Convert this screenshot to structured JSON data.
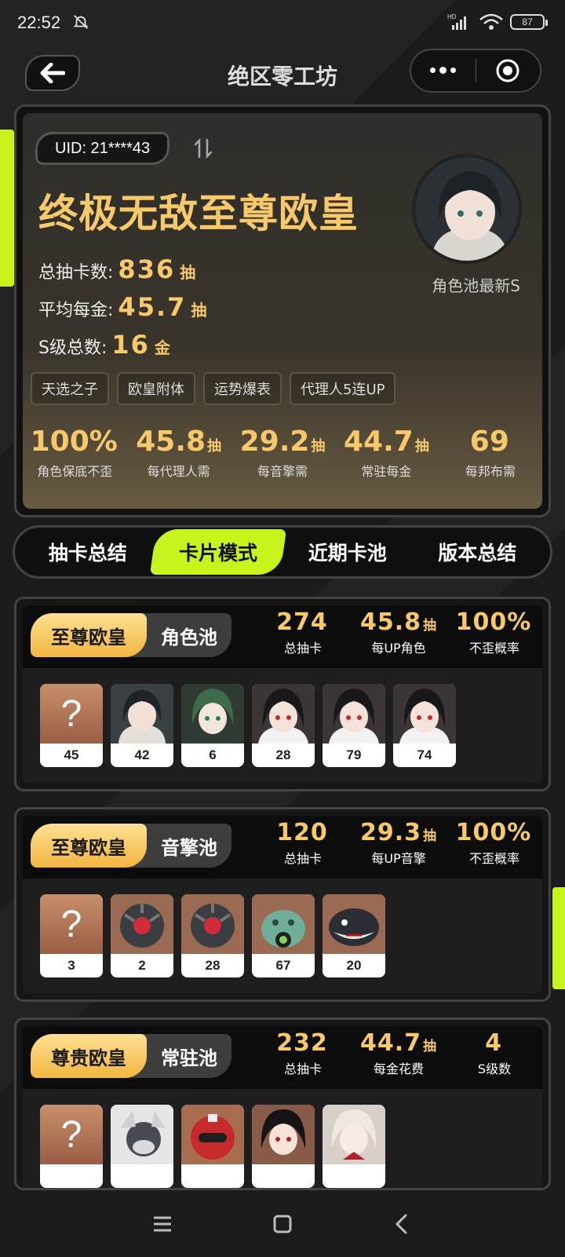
{
  "status_bar": {
    "time": "22:52",
    "battery": "87"
  },
  "header": {
    "title": "绝区零工坊"
  },
  "profile": {
    "uid": "UID: 21****43",
    "rank_title": "终极无敌至尊欧皇",
    "total_pulls_label": "总抽卡数:",
    "total_pulls": "836",
    "avg_gold_label": "平均每金:",
    "avg_gold": "45.7",
    "s_total_label": "S级总数:",
    "s_total": "16",
    "unit_pull": "抽",
    "unit_gold": "金",
    "avatar_caption": "角色池最新S",
    "tags": [
      "天选之子",
      "欧皇附体",
      "运势爆表",
      "代理人5连UP"
    ],
    "summary": [
      {
        "value": "100%",
        "unit": "",
        "label": "角色保底不歪"
      },
      {
        "value": "45.8",
        "unit": "抽",
        "label": "每代理人需"
      },
      {
        "value": "29.2",
        "unit": "抽",
        "label": "每音擎需"
      },
      {
        "value": "44.7",
        "unit": "抽",
        "label": "常驻每金"
      },
      {
        "value": "69",
        "unit": "",
        "label": "每邦布需"
      }
    ]
  },
  "tabs": [
    {
      "label": "抽卡总结",
      "active": false
    },
    {
      "label": "卡片模式",
      "active": true
    },
    {
      "label": "近期卡池",
      "active": false
    },
    {
      "label": "版本总结",
      "active": false
    }
  ],
  "pools": [
    {
      "rank": "至尊欧皇",
      "name": "角色池",
      "stats": [
        {
          "value": "274",
          "unit": "",
          "label": "总抽卡"
        },
        {
          "value": "45.8",
          "unit": "抽",
          "label": "每UP角色"
        },
        {
          "value": "100%",
          "unit": "",
          "label": "不歪概率"
        }
      ],
      "cards": [
        {
          "kind": "unknown",
          "count": "45"
        },
        {
          "kind": "char-dark-hair",
          "count": "42"
        },
        {
          "kind": "char-green-hair",
          "count": "6"
        },
        {
          "kind": "char-black-red",
          "count": "28"
        },
        {
          "kind": "char-black-red",
          "count": "79"
        },
        {
          "kind": "char-black-red",
          "count": "74"
        }
      ]
    },
    {
      "rank": "至尊欧皇",
      "name": "音擎池",
      "stats": [
        {
          "value": "120",
          "unit": "",
          "label": "总抽卡"
        },
        {
          "value": "29.3",
          "unit": "抽",
          "label": "每UP音擎"
        },
        {
          "value": "100%",
          "unit": "",
          "label": "不歪概率"
        }
      ],
      "cards": [
        {
          "kind": "unknown",
          "count": "3"
        },
        {
          "kind": "engine-gray",
          "count": "2"
        },
        {
          "kind": "engine-gray",
          "count": "28"
        },
        {
          "kind": "engine-teal",
          "count": "67"
        },
        {
          "kind": "engine-orca",
          "count": "20"
        }
      ]
    },
    {
      "rank": "尊贵欧皇",
      "name": "常驻池",
      "stats": [
        {
          "value": "232",
          "unit": "",
          "label": "总抽卡"
        },
        {
          "value": "44.7",
          "unit": "抽",
          "label": "每金花费"
        },
        {
          "value": "4",
          "unit": "",
          "label": "S级数"
        }
      ],
      "cards": [
        {
          "kind": "unknown",
          "count": ""
        },
        {
          "kind": "char-wolf",
          "count": ""
        },
        {
          "kind": "char-red-helmet",
          "count": ""
        },
        {
          "kind": "char-black-red",
          "count": ""
        },
        {
          "kind": "char-white-hair",
          "count": ""
        }
      ]
    }
  ],
  "colors": {
    "accent_lime": "#c9f31d",
    "gold": "#f8c96a"
  }
}
